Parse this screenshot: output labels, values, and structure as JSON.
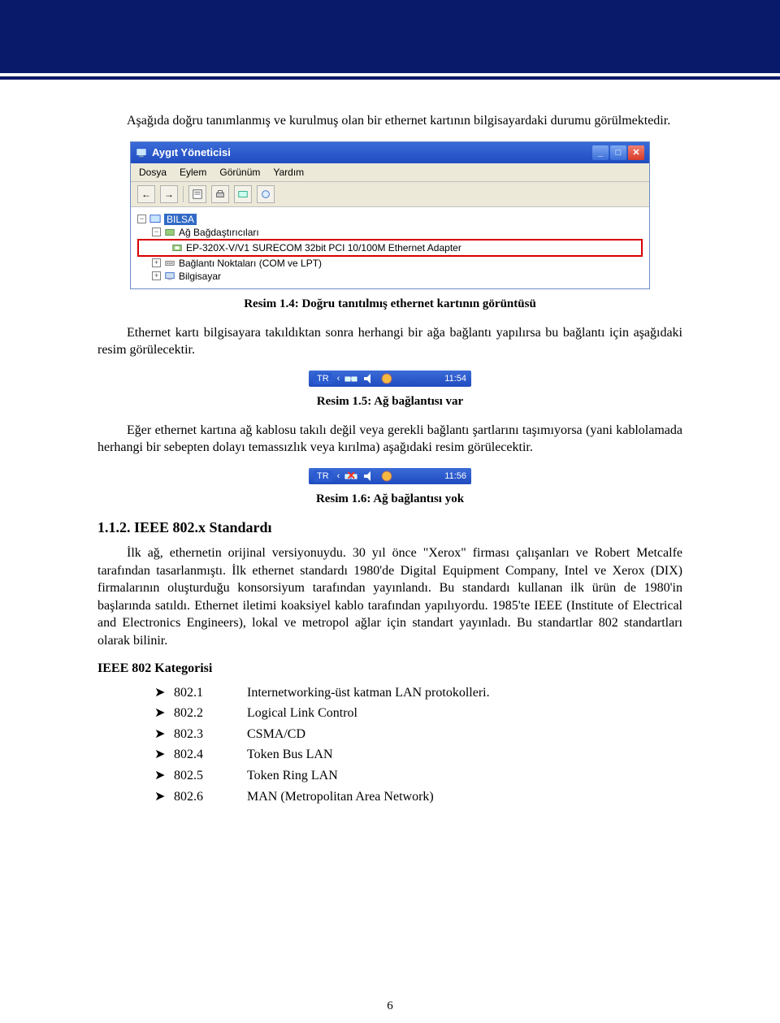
{
  "intro_paragraph": "Aşağıda doğru tanımlanmış ve kurulmuş olan bir ethernet kartının bilgisayardaki durumu görülmektedir.",
  "window": {
    "title": "Aygıt Yöneticisi",
    "menu": {
      "dosya": "Dosya",
      "eylem": "Eylem",
      "gorunum": "Görünüm",
      "yardim": "Yardım"
    },
    "tree": {
      "root": "BILSA",
      "node_ag_bagdastiricilari": "Ağ Bağdaştırıcıları",
      "adapter": "EP-320X-V/V1 SURECOM 32bit PCI 10/100M Ethernet Adapter",
      "node_baglanti_noktalari": "Bağlantı Noktaları (COM ve LPT)",
      "node_bilgisayar": "Bilgisayar"
    }
  },
  "caption_1_4": "Resim 1.4: Doğru tanıtılmış ethernet kartının görüntüsü",
  "paragraph_after_1_4": "Ethernet kartı bilgisayara takıldıktan sonra herhangi bir ağa bağlantı yapılırsa bu bağlantı için aşağıdaki resim görülecektir.",
  "tray1": {
    "lang": "TR",
    "time": "11:54"
  },
  "caption_1_5": "Resim 1.5: Ağ bağlantısı var",
  "paragraph_after_1_5": "Eğer ethernet kartına ağ kablosu takılı değil veya gerekli bağlantı şartlarını taşımıyorsa (yani kablolamada herhangi bir sebepten dolayı temassızlık veya kırılma) aşağıdaki resim görülecektir.",
  "tray2": {
    "lang": "TR",
    "time": "11:56"
  },
  "caption_1_6": "Resim 1.6: Ağ bağlantısı yok",
  "section_title": "1.1.2. IEEE 802.x Standardı",
  "section_paragraph": "İlk ağ, ethernetin orijinal versiyonuydu. 30 yıl önce \"Xerox\" firması çalışanları ve Robert Metcalfe tarafından tasarlanmıştı. İlk ethernet standardı 1980'de Digital Equipment Company, Intel ve Xerox (DIX) firmalarının oluşturduğu konsorsiyum tarafından yayınlandı. Bu standardı kullanan ilk ürün de 1980'in başlarında satıldı. Ethernet iletimi koaksiyel kablo tarafından yapılıyordu. 1985'te IEEE (Institute of Electrical and Electronics Engineers), lokal ve metropol ağlar için standart yayınladı. Bu standartlar 802 standartları olarak bilinir.",
  "ieee_heading": "IEEE 802 Kategorisi",
  "ieee_list": [
    {
      "code": "802.1",
      "desc": "Internetworking-üst katman LAN protokolleri."
    },
    {
      "code": "802.2",
      "desc": "Logical Link Control"
    },
    {
      "code": "802.3",
      "desc": "CSMA/CD"
    },
    {
      "code": "802.4",
      "desc": "Token Bus LAN"
    },
    {
      "code": "802.5",
      "desc": "Token Ring LAN"
    },
    {
      "code": "802.6",
      "desc": "MAN (Metropolitan Area Network)"
    }
  ],
  "page_number": "6"
}
